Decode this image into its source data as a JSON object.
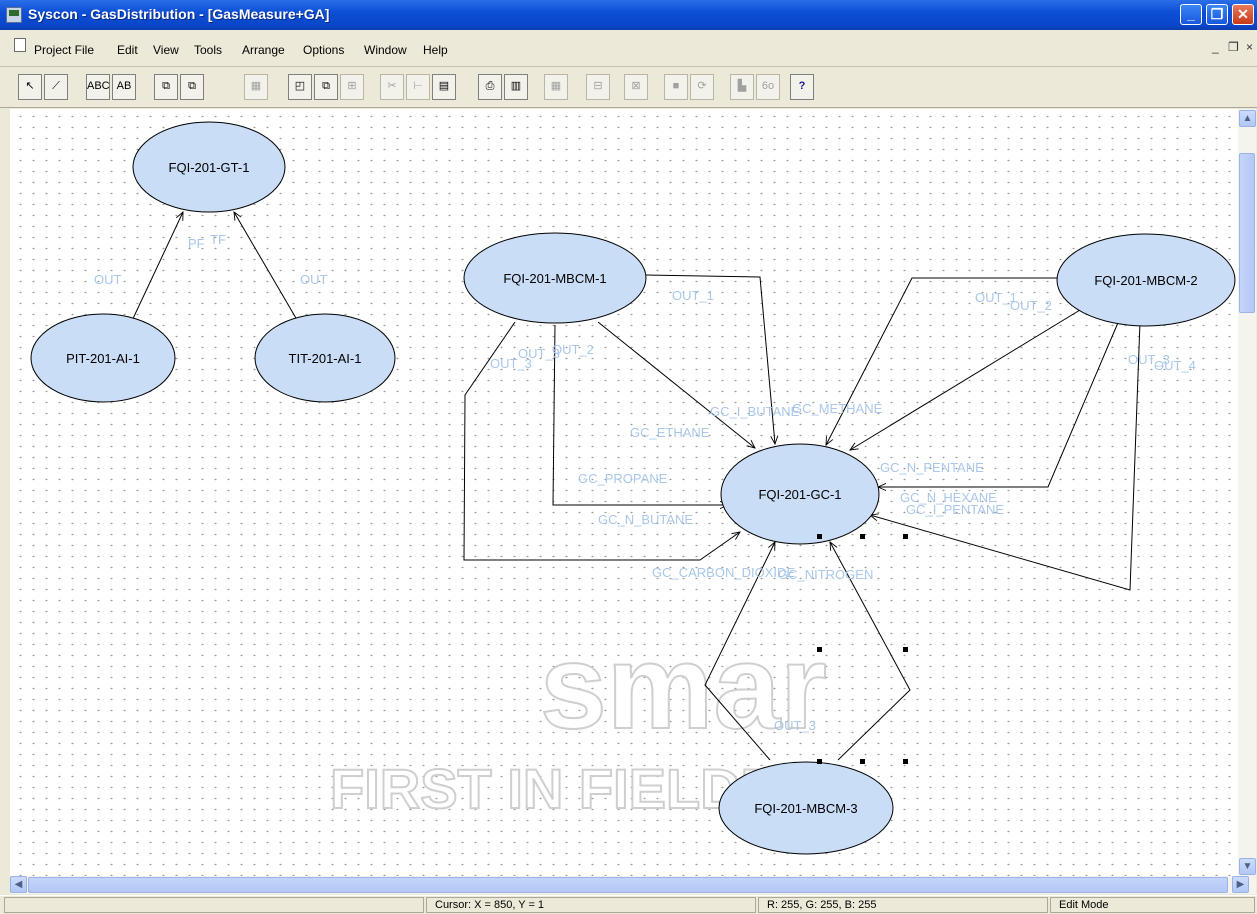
{
  "window": {
    "title": "Syscon - GasDistribution - [GasMeasure+GA]",
    "minimize_label": "_",
    "maximize_label": "❐",
    "close_label": "✕"
  },
  "menu": {
    "items": [
      "Project File",
      "Edit",
      "View",
      "Tools",
      "Arrange",
      "Options",
      "Window",
      "Help"
    ],
    "mdi_minimize": "_",
    "mdi_restore": "❐",
    "mdi_close": "×"
  },
  "toolbar": {
    "buttons": [
      {
        "name": "pointer-tool",
        "glyph": "↖"
      },
      {
        "name": "link-tool",
        "glyph": "⟋"
      },
      {
        "name": "text-tool",
        "glyph": "ABC"
      },
      {
        "name": "label-tool",
        "glyph": "AB"
      },
      {
        "name": "copy-block",
        "glyph": "⧉"
      },
      {
        "name": "paste-block",
        "glyph": "⧉"
      },
      {
        "name": "grid-tool",
        "glyph": "▦"
      },
      {
        "name": "new-block",
        "glyph": "◰"
      },
      {
        "name": "duplicate-block",
        "glyph": "⧉"
      },
      {
        "name": "attach-block",
        "glyph": "⊞"
      },
      {
        "name": "cut",
        "glyph": "✂"
      },
      {
        "name": "align",
        "glyph": "⊢"
      },
      {
        "name": "properties",
        "glyph": "▤"
      },
      {
        "name": "print",
        "glyph": "⎙"
      },
      {
        "name": "view-table",
        "glyph": "▥"
      },
      {
        "name": "export",
        "glyph": "▦"
      },
      {
        "name": "block-a",
        "glyph": "⊟"
      },
      {
        "name": "block-b",
        "glyph": "⊠"
      },
      {
        "name": "stop",
        "glyph": "■"
      },
      {
        "name": "refresh",
        "glyph": "⟳"
      },
      {
        "name": "block-c",
        "glyph": "▙"
      },
      {
        "name": "online",
        "glyph": "6o"
      },
      {
        "name": "help",
        "glyph": "?"
      }
    ]
  },
  "diagram": {
    "blocks": [
      {
        "id": "FQI-201-GT-1"
      },
      {
        "id": "PIT-201-AI-1"
      },
      {
        "id": "TIT-201-AI-1"
      },
      {
        "id": "FQI-201-MBCM-1"
      },
      {
        "id": "FQI-201-MBCM-2"
      },
      {
        "id": "FQI-201-GC-1"
      },
      {
        "id": "FQI-201-MBCM-3"
      }
    ],
    "ports": [
      "PF",
      "TF",
      "OUT",
      "OUT",
      "OUT_1",
      "OUT_2",
      "OUT_1",
      "OUT_2",
      "OUT_3",
      "OUT_4",
      "OUT_3",
      "OUT_3",
      "OUT_3",
      "GC_I_BUTANE",
      "GC_METHANE",
      "GC_ETHANE",
      "GC_PROPANE",
      "GC_N_BUTANE",
      "GC_N_PENTANE",
      "GC_N_HEXANE",
      "GC_I_PENTANE",
      "GC_CARBON_DIOXIDE",
      "GC_NITROGEN"
    ],
    "watermark": {
      "logo": "smar",
      "tagline": "FIRST IN FIELDBUS"
    }
  },
  "statusbar": {
    "cursor": "Cursor: X = 850, Y = 1",
    "color": "R: 255, G: 255, B: 255",
    "mode": "Edit Mode"
  }
}
